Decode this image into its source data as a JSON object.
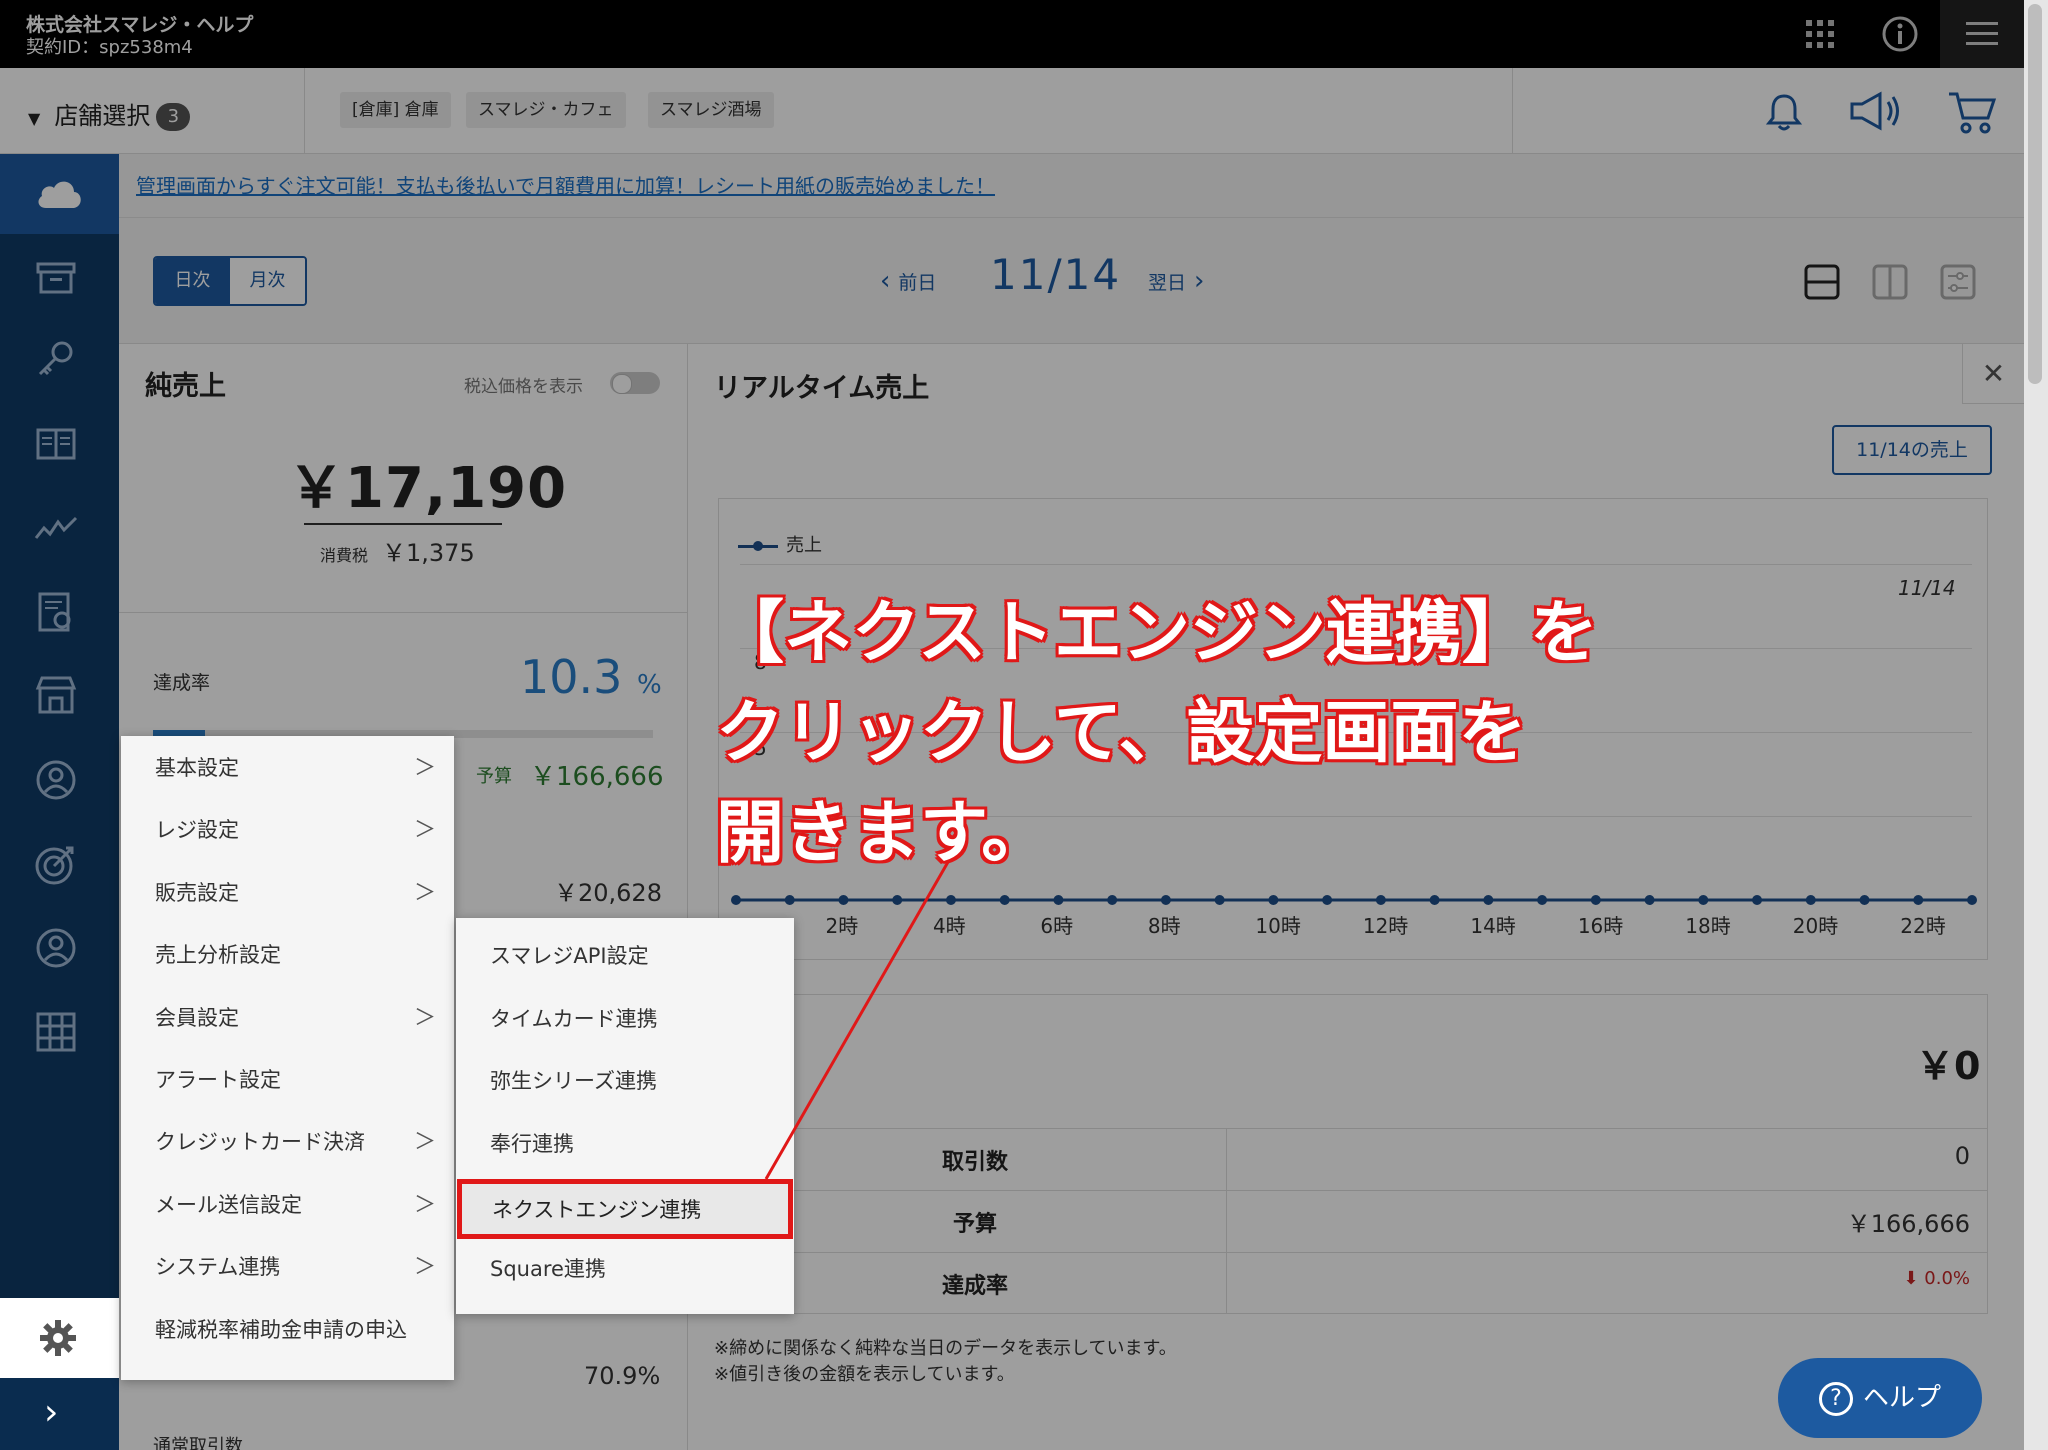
{
  "header": {
    "company": "株式会社スマレジ・ヘルプ",
    "contract": "契約ID：spz538m4",
    "icons": [
      "apps-grid-icon",
      "info-icon",
      "hamburger-menu-icon"
    ]
  },
  "store_bar": {
    "select_label": "店舗選択",
    "count": "3",
    "stores": [
      "[倉庫] 倉庫",
      "スマレジ・カフェ",
      "スマレジ酒場"
    ],
    "icons": [
      "bell-icon",
      "megaphone-icon",
      "cart-icon"
    ]
  },
  "announcement": "管理画面からすぐ注文可能！支払も後払いで月額費用に加算！レシート用紙の販売始めました！",
  "toolbar": {
    "daily": "日次",
    "monthly": "月次",
    "prev": "前日",
    "date": "11/14",
    "next": "翌日"
  },
  "net_sales": {
    "title": "純売上",
    "tax_toggle_label": "税込価格を表示",
    "amount": "￥17,190",
    "tax_label": "消費税",
    "tax_value": "￥1,375",
    "rate_label": "達成率",
    "rate_value": "10.3",
    "rate_unit": "%",
    "rate_fraction": 0.103,
    "budget_label": "予算",
    "budget_value": "￥166,666",
    "value_2": "￥20,628",
    "value_3": "70.9%",
    "row_label": "通常取引数"
  },
  "realtime": {
    "title": "リアルタイム売上",
    "sales_button": "11/14の売上",
    "total": "￥0",
    "rows": [
      {
        "label": "取引数",
        "value": "0"
      },
      {
        "label": "予算",
        "value": "￥166,666"
      },
      {
        "label": "達成率",
        "value": "0.0%"
      }
    ],
    "notes": [
      "※締めに関係なく純粋な当日のデータを表示しています。",
      "※値引き後の金額を表示しています。"
    ]
  },
  "chart_data": {
    "type": "line",
    "series": [
      {
        "name": "売上",
        "values": [
          0,
          0,
          0,
          0,
          0,
          0,
          0,
          0,
          0,
          0,
          0,
          0,
          0,
          0,
          0,
          0,
          0,
          0,
          0,
          0,
          0,
          0,
          0,
          0
        ]
      }
    ],
    "x": [
      0,
      1,
      2,
      3,
      4,
      5,
      6,
      7,
      8,
      9,
      10,
      11,
      12,
      13,
      14,
      15,
      16,
      17,
      18,
      19,
      20,
      21,
      22,
      23
    ],
    "xtick_labels": [
      "2時",
      "4時",
      "6時",
      "8時",
      "10時",
      "12時",
      "14時",
      "16時",
      "18時",
      "20時",
      "22時"
    ],
    "ytick_labels": [
      "8",
      "5"
    ],
    "annotation": "11/14",
    "legend": "top-left",
    "grid": true,
    "color": "#1d4e89"
  },
  "menu": {
    "items": [
      {
        "label": "基本設定",
        "arrow": true
      },
      {
        "label": "レジ設定",
        "arrow": true
      },
      {
        "label": "販売設定",
        "arrow": true
      },
      {
        "label": "売上分析設定",
        "arrow": false
      },
      {
        "label": "会員設定",
        "arrow": true
      },
      {
        "label": "アラート設定",
        "arrow": false
      },
      {
        "label": "クレジットカード決済",
        "arrow": true
      },
      {
        "label": "メール送信設定",
        "arrow": true
      },
      {
        "label": "システム連携",
        "arrow": true
      },
      {
        "label": "軽減税率補助金申請の申込",
        "arrow": false
      }
    ],
    "submenu": [
      "スマレジAPI設定",
      "タイムカード連携",
      "弥生シリーズ連携",
      "奉行連携",
      "ネクストエンジン連携",
      "Square連携"
    ]
  },
  "callout": {
    "line1": "【ネクストエンジン連携】を",
    "line2": "クリックして、設定画面を",
    "line3": "開きます。",
    "color": "#e01818"
  },
  "help_button": "ヘルプ",
  "close_symbol": "✕",
  "arrow_symbol": "＞"
}
